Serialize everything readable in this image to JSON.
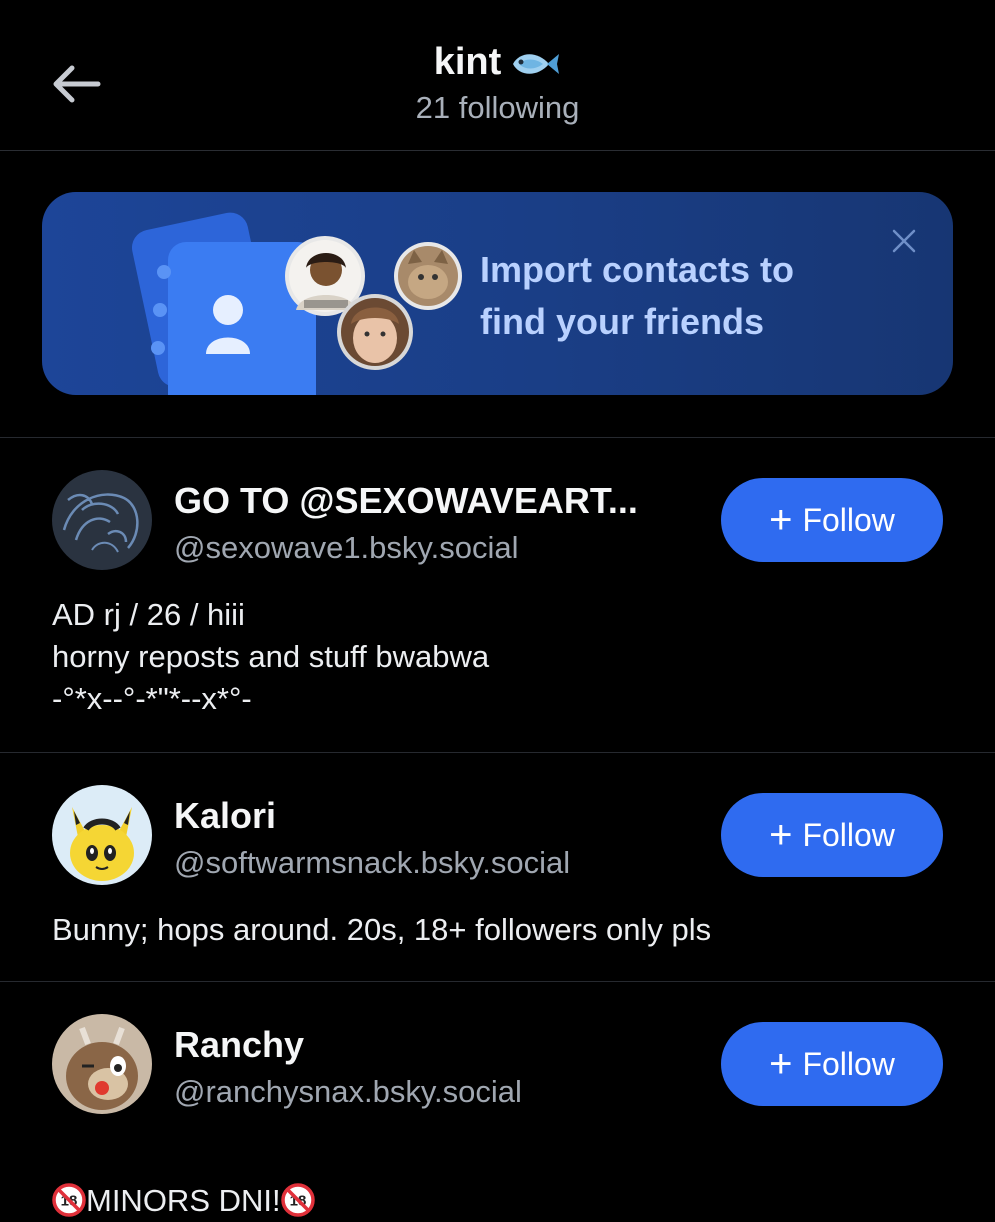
{
  "header": {
    "title": "kint",
    "title_icon": "fish-emoji",
    "subtitle": "21 following"
  },
  "banner": {
    "text": "Import contacts to find your friends",
    "close_icon": "close-icon"
  },
  "users": [
    {
      "name": "GO TO @SEXOWAVEART...",
      "handle": "@sexowave1.bsky.social",
      "follow_label": "Follow",
      "bio": "AD rj / 26 / hiii\nhorny reposts and stuff bwabwa\n-°*x--°-*\"*--x*°-"
    },
    {
      "name": "Kalori",
      "handle": "@softwarmsnack.bsky.social",
      "follow_label": "Follow",
      "bio": "Bunny; hops around. 20s, 18+ followers only pls"
    },
    {
      "name": "Ranchy",
      "handle": "@ranchysnax.bsky.social",
      "follow_label": "Follow",
      "bio": "MINORS DNI!"
    }
  ],
  "colors": {
    "background": "#000000",
    "accent": "#2f6bf0",
    "banner": "#1d4598",
    "banner_text": "#b9d1ff"
  }
}
